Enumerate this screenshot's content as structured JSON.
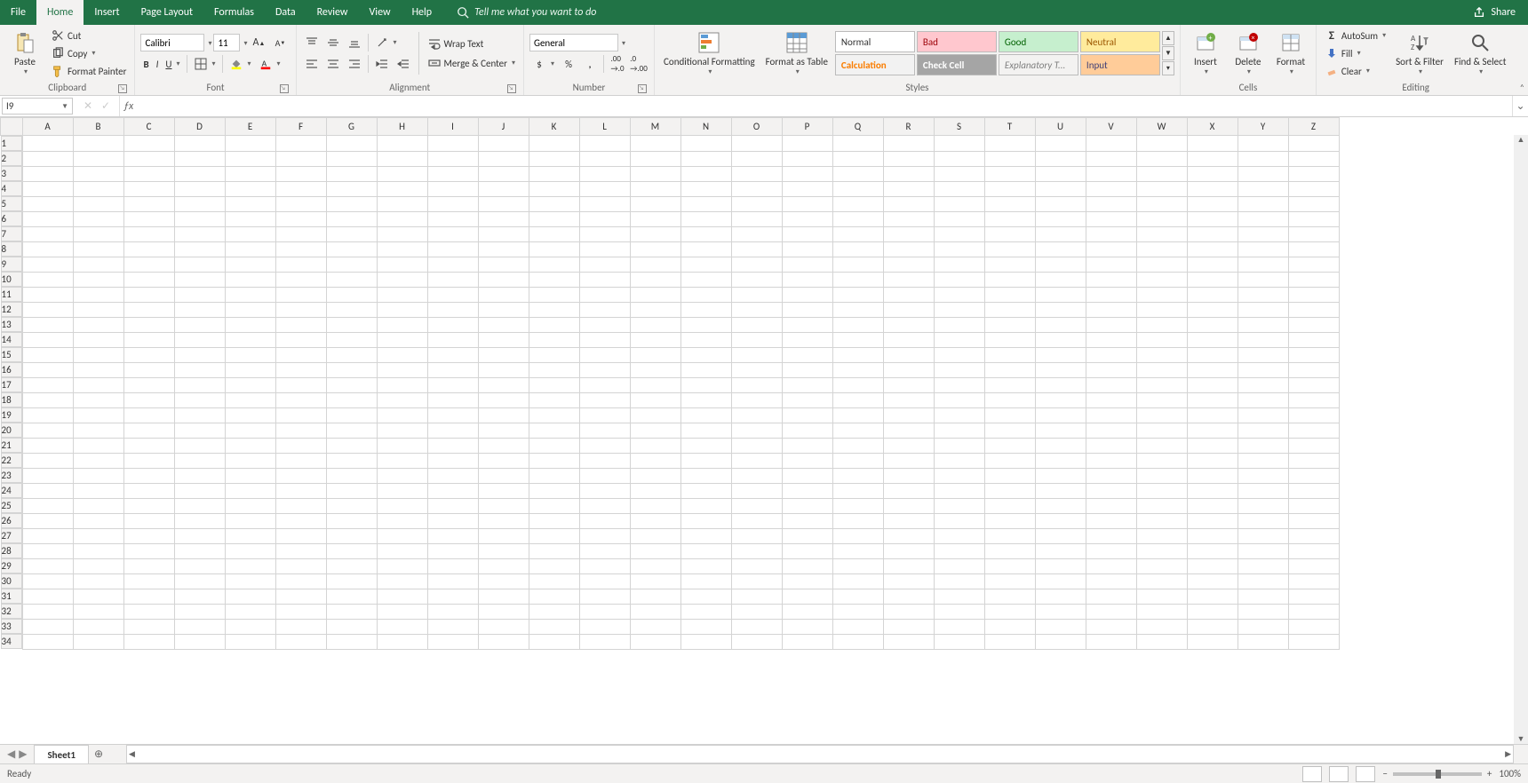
{
  "tabs": [
    "File",
    "Home",
    "Insert",
    "Page Layout",
    "Formulas",
    "Data",
    "Review",
    "View",
    "Help"
  ],
  "active_tab": "Home",
  "tellme_placeholder": "Tell me what you want to do",
  "share_label": "Share",
  "ribbon": {
    "clipboard": {
      "paste": "Paste",
      "cut": "Cut",
      "copy": "Copy",
      "format_painter": "Format Painter",
      "label": "Clipboard"
    },
    "font": {
      "name": "Calibri",
      "size": "11",
      "label": "Font"
    },
    "alignment": {
      "wrap": "Wrap Text",
      "merge": "Merge & Center",
      "label": "Alignment"
    },
    "number": {
      "format": "General",
      "label": "Number"
    },
    "styles": {
      "cond": "Conditional Formatting",
      "table": "Format as Table",
      "cells": [
        "Normal",
        "Bad",
        "Good",
        "Neutral",
        "Calculation",
        "Check Cell",
        "Explanatory T...",
        "Input"
      ],
      "label": "Styles"
    },
    "cells_group": {
      "insert": "Insert",
      "delete": "Delete",
      "format": "Format",
      "label": "Cells"
    },
    "editing": {
      "autosum": "AutoSum",
      "fill": "Fill",
      "clear": "Clear",
      "sort": "Sort & Filter",
      "find": "Find & Select",
      "label": "Editing"
    }
  },
  "namebox": "I9",
  "columns": [
    "A",
    "B",
    "C",
    "D",
    "E",
    "F",
    "G",
    "H",
    "I",
    "J",
    "K",
    "L",
    "M",
    "N",
    "O",
    "P",
    "Q",
    "R",
    "S",
    "T",
    "U",
    "V",
    "W",
    "X",
    "Y",
    "Z"
  ],
  "rows": 34,
  "sheet_tab": "Sheet1",
  "status_text": "Ready",
  "zoom": "100%"
}
